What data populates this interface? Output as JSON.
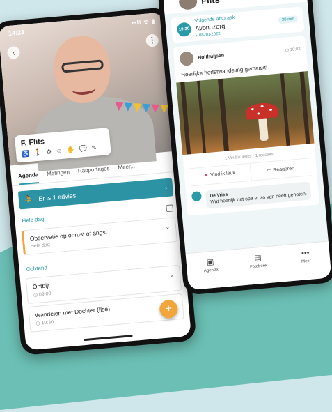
{
  "phone1": {
    "status_time": "14:23",
    "status_icons": "••ll ᯤ ▮",
    "client_name": "F. Flits",
    "traits": "♿ 🚶 ✿ ☺ ✋ 💬 ✎",
    "tabs": [
      {
        "label": "Agenda"
      },
      {
        "label": "Metingen"
      },
      {
        "label": "Rapportages"
      },
      {
        "label": "Meer..."
      }
    ],
    "advice_text": "Er is 1 advies",
    "sections": {
      "whole_day": "Hele dag",
      "morning": "Ochtend"
    },
    "cards": [
      {
        "title": "Observatie op onrust of angst",
        "sub": "Hele dag"
      },
      {
        "title": "Ontbijt",
        "sub": "◷ 09:00"
      },
      {
        "title": "Wandelen met Dochter (Ilse)",
        "sub": "◷ 10:30"
      }
    ]
  },
  "phone2": {
    "title": "Flits",
    "appointment": {
      "time": "10:30",
      "label": "Volgende afspraak",
      "name": "Avondzorg",
      "date": "▸ 08-10-2022",
      "duration": "30 min"
    },
    "post": {
      "author": "Holthuijsen",
      "time": "◷ 10:02",
      "text": "Heerlijke herfstwandeling gemaakt!",
      "stats": "1 Vind ik leuks · 1 reacties",
      "like_label": "Vind ik leuk",
      "reply_label": "Reageren"
    },
    "comment": {
      "author": "De Vries",
      "text": "Wat heerlijk dat opa er zo van heeft genoten!"
    },
    "nav": [
      {
        "label": "Agenda",
        "icon": "▣"
      },
      {
        "label": "Fotoboek",
        "icon": "▤"
      },
      {
        "label": "Meer",
        "icon": "•••"
      }
    ]
  },
  "colors": {
    "accent": "#2a9aa8",
    "fab": "#f2a53a",
    "like": "#e0405a",
    "mushroom": "#c8302a"
  }
}
